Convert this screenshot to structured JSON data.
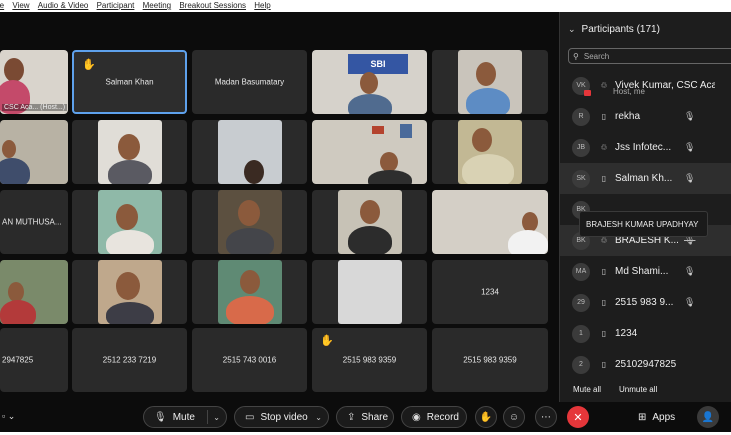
{
  "menu": [
    "re",
    "View",
    "Audio & Video",
    "Participant",
    "Meeting",
    "Breakout Sessions",
    "Help"
  ],
  "tiles": {
    "host_label": "CSC Aca... (Host...)",
    "salman": "Salman Khan",
    "madan": "Madan Basumatary",
    "row3_name": "AN MUTHUSA...",
    "t1234": "1234",
    "num1": "2947825",
    "num2": "2512 233 7219",
    "num3": "2515 743 0016",
    "num4": "2515 983 9359",
    "num5": "2515 983 9359",
    "sbi_sign": "SBI"
  },
  "panel": {
    "title": "Participants (171)",
    "search_placeholder": "Search",
    "participants": [
      {
        "initials": "VK",
        "name": "Vivek Kumar, CSC Aca...",
        "sub": "Host, me"
      },
      {
        "initials": "R",
        "name": "rekha"
      },
      {
        "initials": "JB",
        "name": "Jss Infotec..."
      },
      {
        "initials": "SK",
        "name": "Salman Kh..."
      },
      {
        "initials": "BK",
        "name": ""
      },
      {
        "initials": "BK",
        "name": "BRAJESH K..."
      },
      {
        "initials": "MA",
        "name": "Md Shami..."
      },
      {
        "initials": "29",
        "name": "2515 983 9..."
      },
      {
        "initials": "1",
        "name": "1234"
      },
      {
        "initials": "2",
        "name": "25102947825"
      }
    ],
    "tooltip": "BRAJESH KUMAR UPADHYAY",
    "mute_all": "Mute all",
    "unmute_all": "Unmute all"
  },
  "toolbar": {
    "mute": "Mute",
    "stop_video": "Stop video",
    "share": "Share",
    "record": "Record",
    "apps": "Apps"
  }
}
